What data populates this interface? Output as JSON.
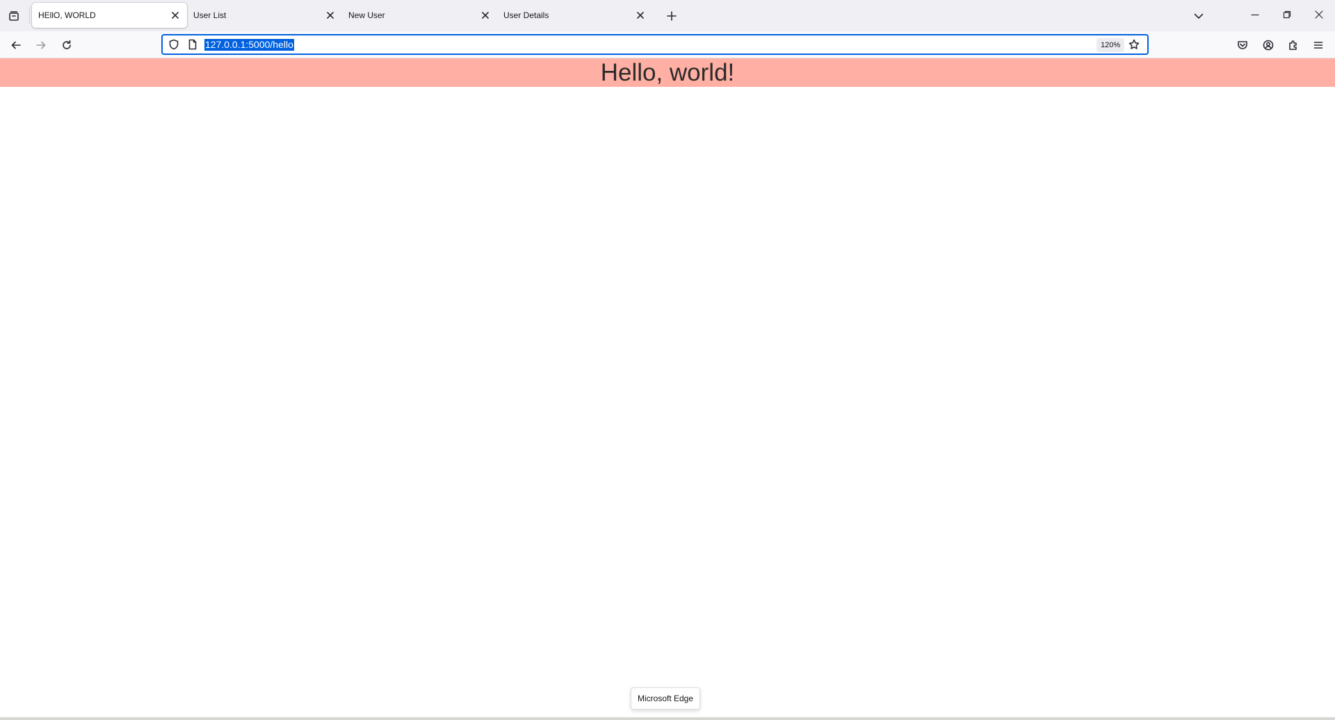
{
  "tabs": [
    {
      "title": "HEllO, WORLD",
      "active": true
    },
    {
      "title": "User List",
      "active": false
    },
    {
      "title": "New User",
      "active": false
    },
    {
      "title": "User Details",
      "active": false
    }
  ],
  "address_bar": {
    "url": "127.0.0.1:5000/hello",
    "zoom": "120%"
  },
  "page": {
    "heading": "Hello, world!",
    "banner_color": "#ffafa3"
  },
  "tooltip": {
    "text": "Microsoft Edge"
  },
  "colors": {
    "accent": "#0061e0"
  }
}
